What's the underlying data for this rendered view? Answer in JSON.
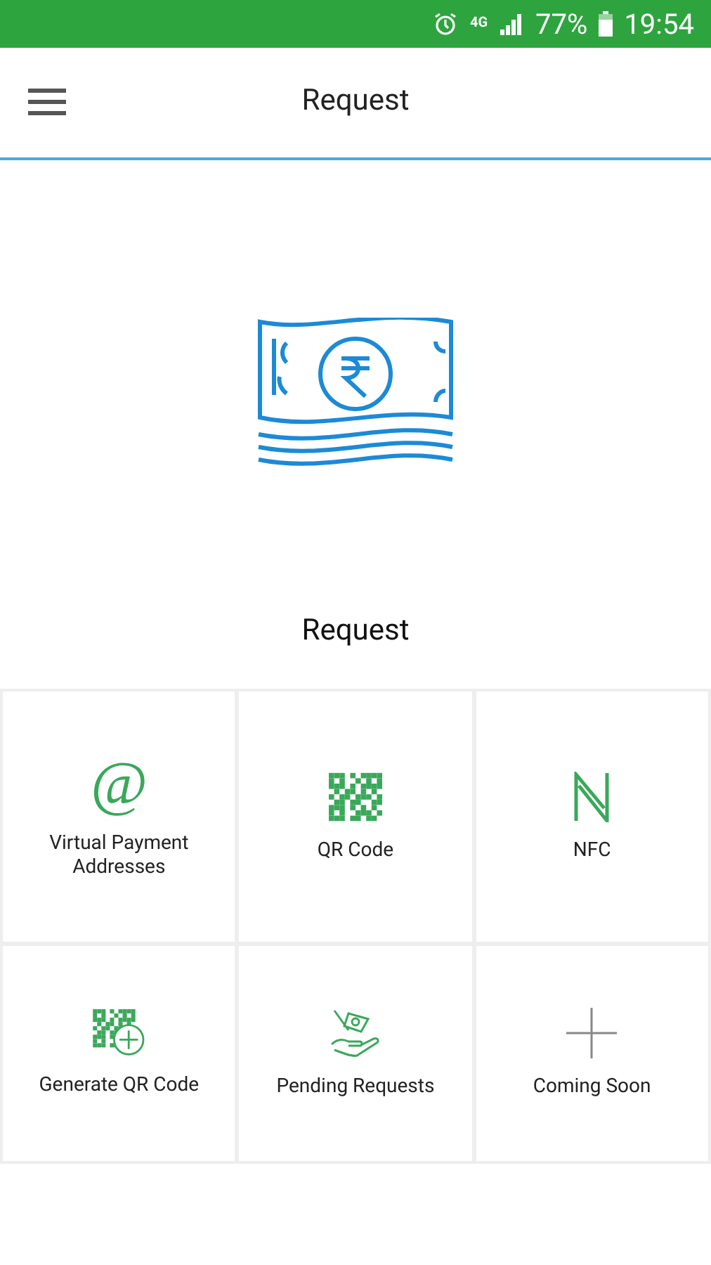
{
  "status_bar": {
    "network": "4G",
    "battery": "77%",
    "time": "19:54"
  },
  "app_bar": {
    "title": "Request"
  },
  "hero": {
    "caption": "Request"
  },
  "tiles": [
    {
      "kind": "at",
      "glyph": "@",
      "label": "Virtual Payment Addresses"
    },
    {
      "kind": "qr",
      "label": "QR Code"
    },
    {
      "kind": "nfc",
      "label": "NFC"
    },
    {
      "kind": "qr-plus",
      "label": "Generate QR Code"
    },
    {
      "kind": "hand",
      "label": "Pending Requests"
    },
    {
      "kind": "plus",
      "label": "Coming Soon"
    }
  ]
}
